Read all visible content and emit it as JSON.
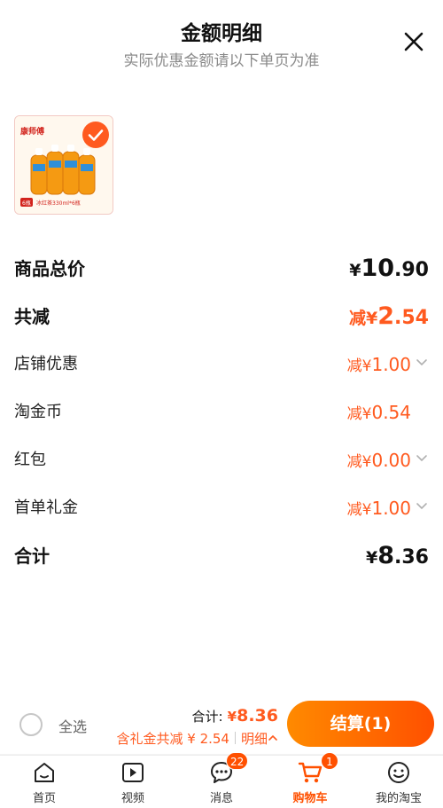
{
  "header": {
    "title": "金额明细",
    "subtitle": "实际优惠金额请以下单页为准"
  },
  "product": {
    "brand_text": "康师傅",
    "tag": "6瓶",
    "caption": "冰红茶330ml*6瓶",
    "selected": true
  },
  "breakdown": [
    {
      "label": "商品总价",
      "prefix": "",
      "currency": "¥",
      "int": "10",
      "dec": ".90",
      "style": "dark",
      "chevron": false
    },
    {
      "label": "共减",
      "prefix": "减",
      "currency": "¥",
      "int": "2",
      "dec": ".54",
      "style": "orange-b",
      "chevron": false
    },
    {
      "label": "店铺优惠",
      "prefix": "减",
      "currency": "¥",
      "int": "1",
      "dec": ".00",
      "style": "orange",
      "chevron": true
    },
    {
      "label": "淘金币",
      "prefix": "减",
      "currency": "¥",
      "int": "0",
      "dec": ".54",
      "style": "orange",
      "chevron": false
    },
    {
      "label": "红包",
      "prefix": "减",
      "currency": "¥",
      "int": "0",
      "dec": ".00",
      "style": "orange",
      "chevron": true
    },
    {
      "label": "首单礼金",
      "prefix": "减",
      "currency": "¥",
      "int": "1",
      "dec": ".00",
      "style": "orange",
      "chevron": true
    },
    {
      "label": "合计",
      "prefix": "",
      "currency": "¥",
      "int": "8",
      "dec": ".36",
      "style": "dark",
      "chevron": false
    }
  ],
  "checkout": {
    "select_all_label": "全选",
    "total_label": "合计:",
    "total_currency": "¥",
    "total_value": "8.36",
    "discount_text": "含礼金共减 ¥ 2.54",
    "detail_label": "明细",
    "settle_label": "结算(1)"
  },
  "tabbar": [
    {
      "label": "首页",
      "icon": "home-icon",
      "badge": ""
    },
    {
      "label": "视频",
      "icon": "video-icon",
      "badge": ""
    },
    {
      "label": "消息",
      "icon": "message-icon",
      "badge": "22"
    },
    {
      "label": "购物车",
      "icon": "cart-icon",
      "badge": "1"
    },
    {
      "label": "我的淘宝",
      "icon": "profile-icon",
      "badge": ""
    }
  ],
  "colors": {
    "accent": "#ff5a1f",
    "button_start": "#ff8a00",
    "button_end": "#ff5000"
  }
}
